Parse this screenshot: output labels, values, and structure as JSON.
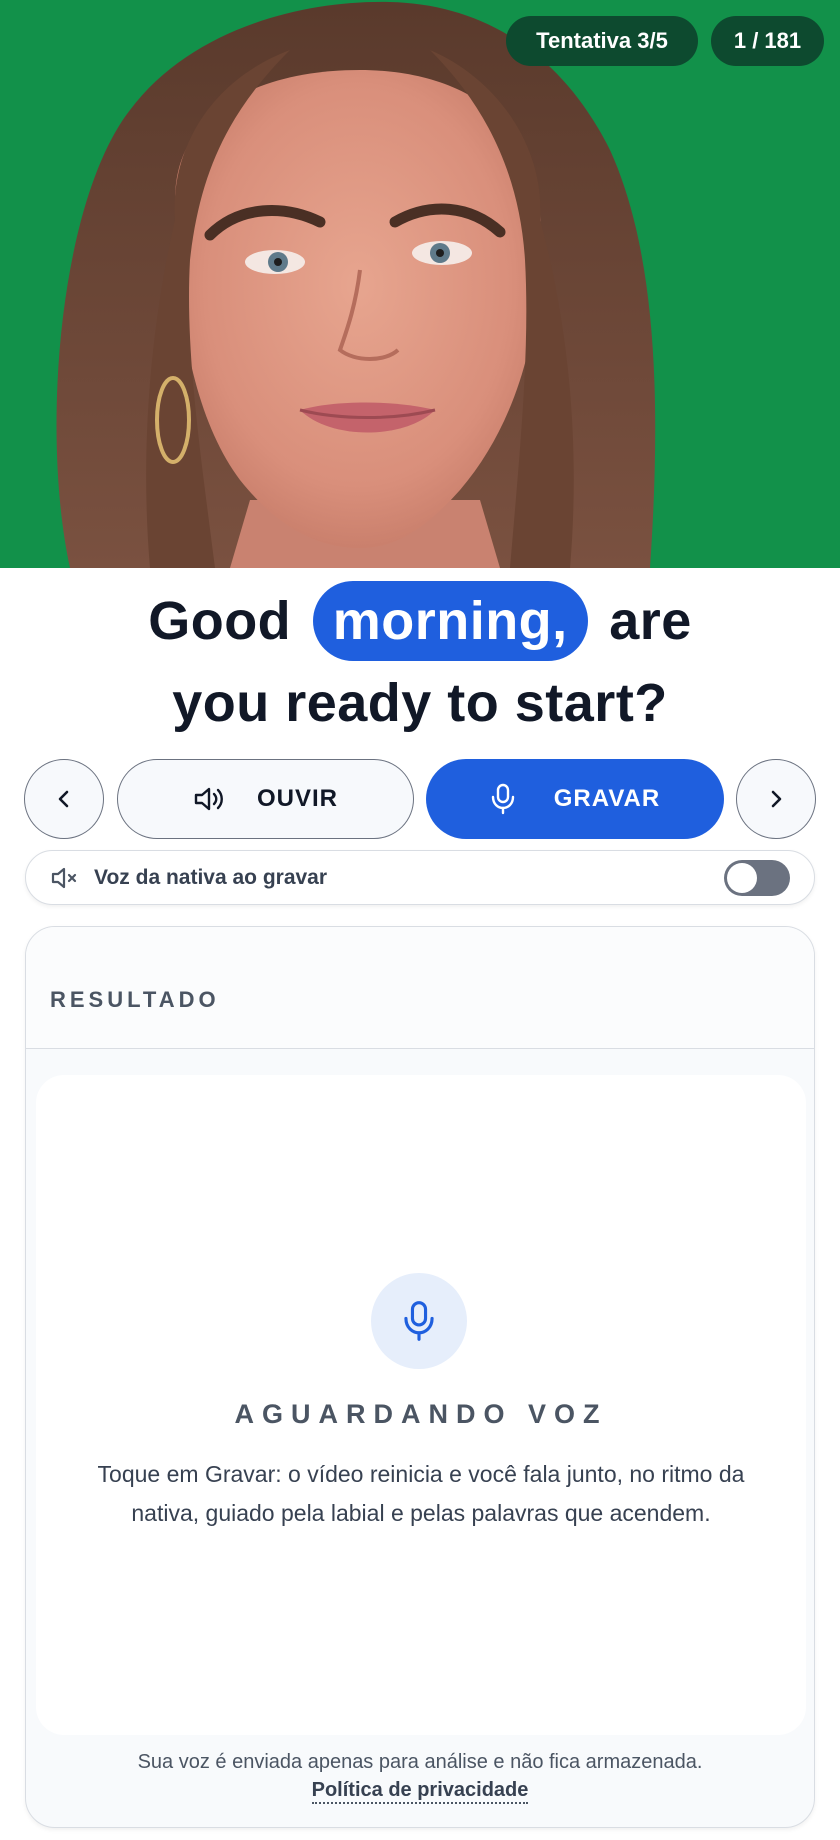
{
  "video": {
    "attempt_label": "Tentativa 3/5",
    "counter_label": "1 / 181",
    "background_color": "#12914a"
  },
  "sentence": {
    "before": "Good",
    "highlight": "morning,",
    "after": "are",
    "line2": "you ready to start?"
  },
  "controls": {
    "prev_icon": "chevron-left-icon",
    "next_icon": "chevron-right-icon",
    "listen_label": "OUVIR",
    "listen_icon": "speaker-icon",
    "record_label": "GRAVAR",
    "record_icon": "microphone-icon",
    "accent_color": "#1f5fde"
  },
  "native_voice_toggle": {
    "icon": "speaker-muted-icon",
    "label": "Voz da nativa ao gravar",
    "enabled": false
  },
  "result": {
    "title": "RESULTADO",
    "status_icon": "microphone-icon",
    "status": "AGUARDANDO VOZ",
    "hint": "Toque em Gravar: o vídeo reinicia e você fala junto, no ritmo da nativa, guiado pela labial e pelas palavras que acendem.",
    "footer_note": "Sua voz é enviada apenas para análise e não fica armazenada.",
    "privacy_link": "Política de privacidade"
  }
}
